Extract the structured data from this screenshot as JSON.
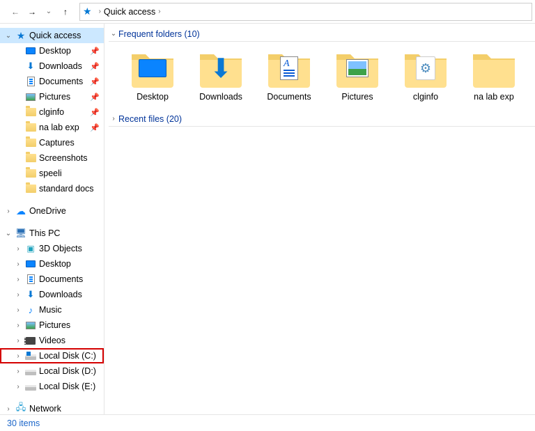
{
  "address_bar": {
    "crumb1": "Quick access"
  },
  "sidebar": {
    "quick_access": {
      "label": "Quick access"
    },
    "qa_items": [
      {
        "label": "Desktop",
        "pinned": true,
        "type": "desktop"
      },
      {
        "label": "Downloads",
        "pinned": true,
        "type": "dl"
      },
      {
        "label": "Documents",
        "pinned": true,
        "type": "doc"
      },
      {
        "label": "Pictures",
        "pinned": true,
        "type": "pic"
      },
      {
        "label": "clginfo",
        "pinned": true,
        "type": "folder"
      },
      {
        "label": "na lab exp",
        "pinned": true,
        "type": "folder"
      },
      {
        "label": "Captures",
        "pinned": false,
        "type": "folder"
      },
      {
        "label": "Screenshots",
        "pinned": false,
        "type": "folder"
      },
      {
        "label": "speeli",
        "pinned": false,
        "type": "folder"
      },
      {
        "label": "standard docs",
        "pinned": false,
        "type": "folder"
      }
    ],
    "onedrive": {
      "label": "OneDrive"
    },
    "this_pc": {
      "label": "This PC"
    },
    "pc_items": [
      {
        "label": "3D Objects",
        "type": "3d"
      },
      {
        "label": "Desktop",
        "type": "desktop"
      },
      {
        "label": "Documents",
        "type": "doc"
      },
      {
        "label": "Downloads",
        "type": "dl"
      },
      {
        "label": "Music",
        "type": "music"
      },
      {
        "label": "Pictures",
        "type": "pic"
      },
      {
        "label": "Videos",
        "type": "video"
      },
      {
        "label": "Local Disk (C:)",
        "type": "disk-c"
      },
      {
        "label": "Local Disk (D:)",
        "type": "disk"
      },
      {
        "label": "Local Disk (E:)",
        "type": "disk"
      }
    ],
    "network": {
      "label": "Network"
    }
  },
  "groups": {
    "frequent": {
      "label": "Frequent folders (10)"
    },
    "recent": {
      "label": "Recent files (20)"
    }
  },
  "tiles": [
    {
      "label": "Desktop",
      "overlay": "desktop"
    },
    {
      "label": "Downloads",
      "overlay": "dl"
    },
    {
      "label": "Documents",
      "overlay": "doc"
    },
    {
      "label": "Pictures",
      "overlay": "pic"
    },
    {
      "label": "clginfo",
      "overlay": "py"
    },
    {
      "label": "na lab exp",
      "overlay": "none"
    }
  ],
  "status": {
    "items": "30 items"
  }
}
